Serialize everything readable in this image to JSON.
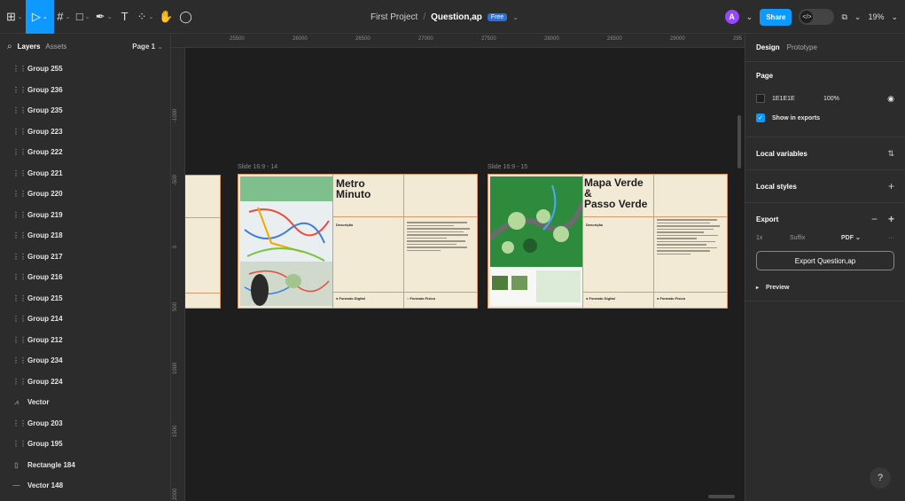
{
  "toolbar": {
    "tools": [
      {
        "icon": "main-menu-icon",
        "glyph": "⊞",
        "name": "main-menu"
      },
      {
        "icon": "move-icon",
        "glyph": "▷",
        "name": "move-tool",
        "active": true
      },
      {
        "icon": "frame-icon",
        "glyph": "#",
        "name": "frame-tool"
      },
      {
        "icon": "rectangle-icon",
        "glyph": "□",
        "name": "shape-tool"
      },
      {
        "icon": "pen-icon",
        "glyph": "✒",
        "name": "pen-tool"
      },
      {
        "icon": "text-icon",
        "glyph": "T",
        "name": "text-tool"
      },
      {
        "icon": "resources-icon",
        "glyph": "⁘",
        "name": "resources-tool"
      },
      {
        "icon": "hand-icon",
        "glyph": "✋",
        "name": "hand-tool"
      },
      {
        "icon": "comment-icon",
        "glyph": "◯",
        "name": "comment-tool"
      }
    ],
    "project_name": "First Project",
    "separator": "/",
    "file_name": "Question,ap",
    "plan_badge": "Free",
    "avatar_initial": "A",
    "share_label": "Share",
    "dev_mode_glyph": "</>",
    "zoom": "19%"
  },
  "layers_panel": {
    "tab_layers": "Layers",
    "tab_assets": "Assets",
    "page_selector": "Page 1",
    "items": [
      {
        "label": "Group 255",
        "icon": "group-icon",
        "glyph": "⋮⋮"
      },
      {
        "label": "Group 236",
        "icon": "group-icon",
        "glyph": "⋮⋮"
      },
      {
        "label": "Group 235",
        "icon": "group-icon",
        "glyph": "⋮⋮"
      },
      {
        "label": "Group 223",
        "icon": "group-icon",
        "glyph": "⋮⋮"
      },
      {
        "label": "Group 222",
        "icon": "group-icon",
        "glyph": "⋮⋮"
      },
      {
        "label": "Group 221",
        "icon": "group-icon",
        "glyph": "⋮⋮"
      },
      {
        "label": "Group 220",
        "icon": "group-icon",
        "glyph": "⋮⋮"
      },
      {
        "label": "Group 219",
        "icon": "group-icon",
        "glyph": "⋮⋮"
      },
      {
        "label": "Group 218",
        "icon": "group-icon",
        "glyph": "⋮⋮"
      },
      {
        "label": "Group 217",
        "icon": "group-icon",
        "glyph": "⋮⋮"
      },
      {
        "label": "Group 216",
        "icon": "group-icon",
        "glyph": "⋮⋮"
      },
      {
        "label": "Group 215",
        "icon": "group-icon",
        "glyph": "⋮⋮"
      },
      {
        "label": "Group 214",
        "icon": "group-icon",
        "glyph": "⋮⋮"
      },
      {
        "label": "Group 212",
        "icon": "group-icon",
        "glyph": "⋮⋮"
      },
      {
        "label": "Group 234",
        "icon": "group-icon",
        "glyph": "⋮⋮"
      },
      {
        "label": "Group 224",
        "icon": "group-icon",
        "glyph": "⋮⋮"
      },
      {
        "label": "Vector",
        "icon": "vector-icon",
        "glyph": "⩘"
      },
      {
        "label": "Group 203",
        "icon": "group-icon",
        "glyph": "⋮⋮"
      },
      {
        "label": "Group 195",
        "icon": "group-icon",
        "glyph": "⋮⋮"
      },
      {
        "label": "Rectangle 184",
        "icon": "rectangle-icon",
        "glyph": "▯"
      },
      {
        "label": "Vector 148",
        "icon": "line-icon",
        "glyph": "—"
      }
    ]
  },
  "rulers": {
    "top": [
      "25500",
      "26000",
      "26500",
      "27000",
      "27500",
      "28000",
      "28500",
      "29000",
      "295"
    ],
    "left": [
      "-1000",
      "-500",
      "0",
      "500",
      "1000",
      "1500",
      "2000"
    ]
  },
  "canvas": {
    "slide_14": {
      "label": "Slide 16:9 - 14",
      "title_line1": "Metro",
      "title_line2": "Minuto",
      "description_label": "Descrição",
      "format_digital": "● Formato Digital",
      "format_fisico": "○ Formato Físico"
    },
    "slide_15": {
      "label": "Slide 16:9 - 15",
      "title_line1": "Mapa Verde",
      "title_line2": "&",
      "title_line3": "Passo Verde",
      "description_label": "Descrição",
      "format_digital": "● Formato Digital",
      "format_fisico": "● Formato Físico"
    }
  },
  "design_panel": {
    "tab_design": "Design",
    "tab_prototype": "Prototype",
    "page_heading": "Page",
    "page_color": "1E1E1E",
    "page_opacity": "100%",
    "show_in_exports": "Show in exports",
    "local_variables": "Local variables",
    "local_styles": "Local styles",
    "export_heading": "Export",
    "export_scale": "1x",
    "export_suffix_placeholder": "Suffix",
    "export_format": "PDF",
    "export_button": "Export Question,ap",
    "preview_label": "Preview",
    "help_glyph": "?"
  },
  "colors": {
    "accent": "#0d99ff",
    "canvas_bg": "#1e1e1e",
    "panel_bg": "#2c2c2c",
    "slide_bg": "#f3ead6",
    "slide_border": "#d79b6e"
  }
}
